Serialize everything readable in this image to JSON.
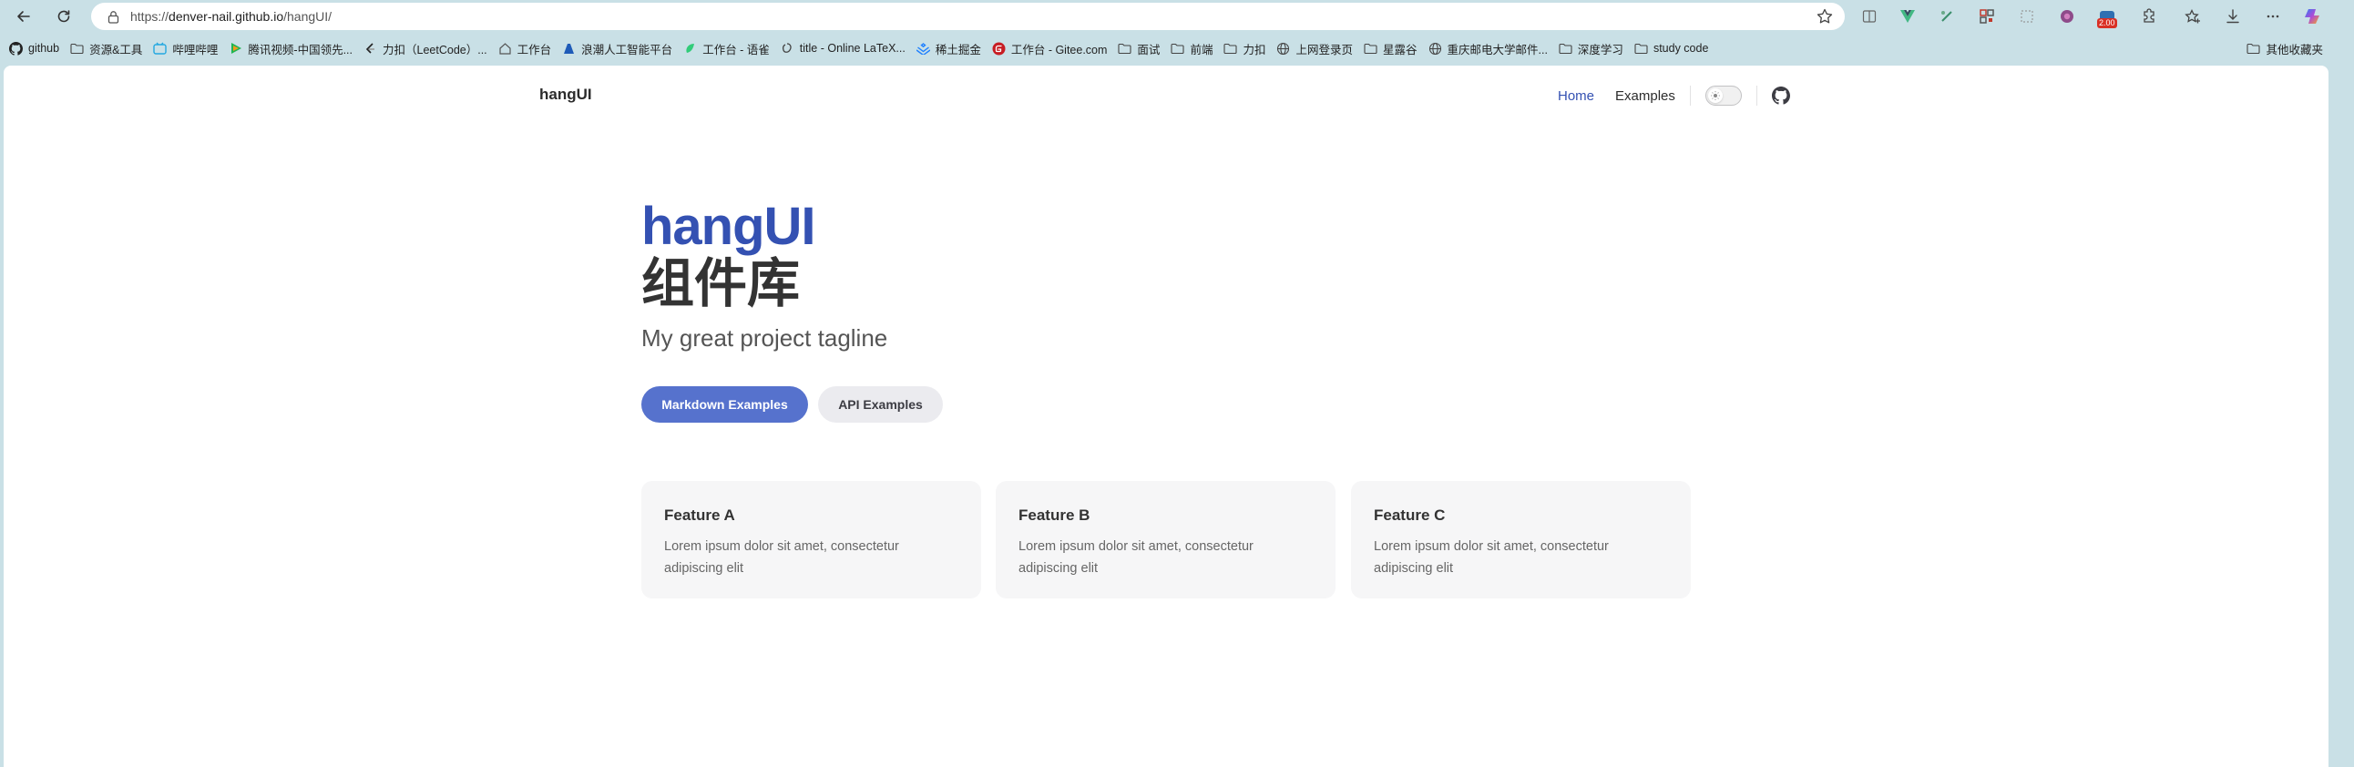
{
  "browser": {
    "url_prefix": "https://",
    "url_host": "denver-nail.github.io",
    "url_path": "/hangUI/",
    "bookmarks": [
      {
        "label": "github",
        "icon": "github-icon"
      },
      {
        "label": "资源&工具",
        "icon": "folder-icon"
      },
      {
        "label": "哔哩哔哩",
        "icon": "bilibili-icon"
      },
      {
        "label": "腾讯视频-中国领先...",
        "icon": "tencent-video-icon"
      },
      {
        "label": "力扣（LeetCode）...",
        "icon": "leetcode-icon"
      },
      {
        "label": "工作台",
        "icon": "home-icon"
      },
      {
        "label": "浪潮人工智能平台",
        "icon": "inspur-icon"
      },
      {
        "label": "工作台 - 语雀",
        "icon": "yuque-icon"
      },
      {
        "label": "title - Online LaTeX...",
        "icon": "overleaf-icon"
      },
      {
        "label": "稀土掘金",
        "icon": "juejin-icon"
      },
      {
        "label": "工作台 - Gitee.com",
        "icon": "gitee-icon"
      },
      {
        "label": "面试",
        "icon": "folder-icon"
      },
      {
        "label": "前端",
        "icon": "folder-icon"
      },
      {
        "label": "力扣",
        "icon": "folder-icon"
      },
      {
        "label": "上网登录页",
        "icon": "globe-icon"
      },
      {
        "label": "星露谷",
        "icon": "folder-icon"
      },
      {
        "label": "重庆邮电大学邮件...",
        "icon": "globe-icon"
      },
      {
        "label": "深度学习",
        "icon": "folder-icon"
      },
      {
        "label": "study code",
        "icon": "folder-icon"
      }
    ],
    "other_bookmarks": "其他收藏夹",
    "badge": "2.00"
  },
  "site": {
    "brand": "hangUI",
    "nav": {
      "home": "Home",
      "examples": "Examples"
    },
    "active_color": "#3451b2"
  },
  "hero": {
    "name": "hangUI",
    "text": "组件库",
    "tagline": "My great project tagline",
    "actions": {
      "primary": "Markdown Examples",
      "secondary": "API Examples"
    }
  },
  "features": [
    {
      "title": "Feature A",
      "details": "Lorem ipsum dolor sit amet, consectetur adipiscing elit"
    },
    {
      "title": "Feature B",
      "details": "Lorem ipsum dolor sit amet, consectetur adipiscing elit"
    },
    {
      "title": "Feature C",
      "details": "Lorem ipsum dolor sit amet, consectetur adipiscing elit"
    }
  ]
}
